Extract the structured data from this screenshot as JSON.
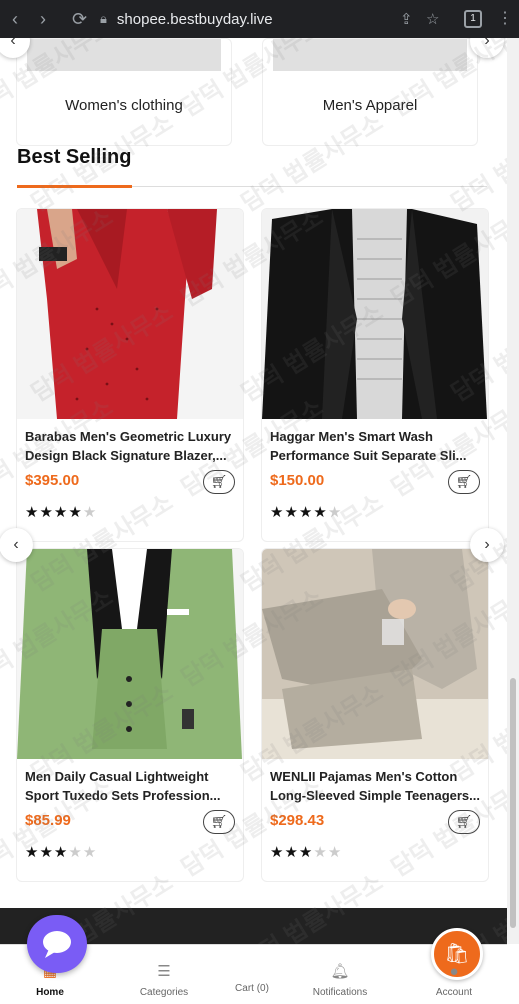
{
  "browser": {
    "url": "shopee.bestbuyday.live",
    "tab_count": "1"
  },
  "categories": [
    {
      "name": "Women's clothing"
    },
    {
      "name": "Men's Apparel"
    }
  ],
  "section": {
    "title": "Best Selling"
  },
  "products": [
    {
      "name_line1": "Barabas Men's Geometric Luxury",
      "name_line2": "Design Black Signature Blazer,...",
      "price": "$395.00",
      "rating": 4
    },
    {
      "name_line1": "Haggar Men's Smart Wash",
      "name_line2": "Performance Suit Separate Sli...",
      "price": "$150.00",
      "rating": 4
    },
    {
      "name_line1": "Men Daily Casual Lightweight",
      "name_line2": "Sport Tuxedo Sets Profession...",
      "price": "$85.99",
      "rating": 3
    },
    {
      "name_line1": "WENLII Pajamas Men's Cotton",
      "name_line2": "Long-Sleeved Simple Teenagers...",
      "price": "$298.43",
      "rating": 3
    }
  ],
  "bottom_nav": {
    "home": "Home",
    "categories": "Categories",
    "cart": "Cart (0)",
    "notifications": "Notifications",
    "account": "Account"
  },
  "watermark": "담덕 법률사무소",
  "colors": {
    "accent": "#ee6a1c",
    "chat": "#7a5cf5",
    "browser_bar": "#202124"
  }
}
